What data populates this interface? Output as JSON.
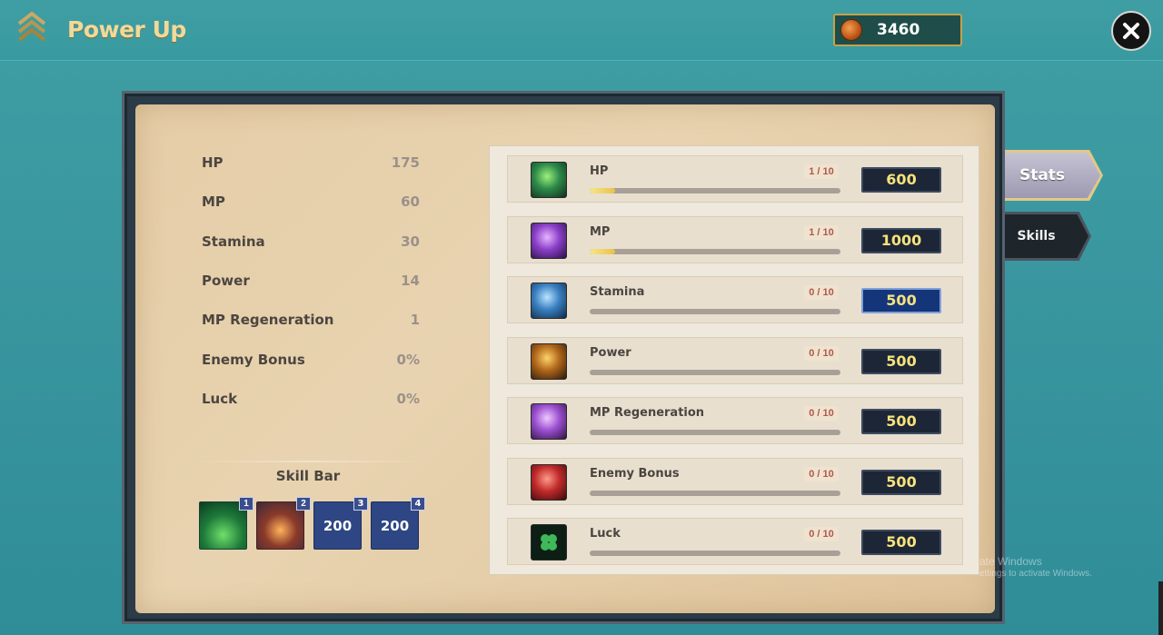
{
  "header": {
    "title": "Power Up",
    "currency_value": "3460",
    "currency_icon": "coin-icon",
    "close_icon": "close-icon"
  },
  "stats": [
    {
      "label": "HP",
      "value": "175"
    },
    {
      "label": "MP",
      "value": "60"
    },
    {
      "label": "Stamina",
      "value": "30"
    },
    {
      "label": "Power",
      "value": "14"
    },
    {
      "label": "MP Regeneration",
      "value": "1"
    },
    {
      "label": "Enemy Bonus",
      "value": "0%"
    },
    {
      "label": "Luck",
      "value": "0%"
    }
  ],
  "skill_bar": {
    "title": "Skill Bar",
    "slots": [
      {
        "number": "1",
        "icon": "skill-slime-icon"
      },
      {
        "number": "2",
        "icon": "skill-meteor-icon"
      },
      {
        "number": "3",
        "cost": "200"
      },
      {
        "number": "4",
        "cost": "200"
      }
    ]
  },
  "upgrades": [
    {
      "name": "HP",
      "level": "1 / 10",
      "progress": 0.1,
      "cost": "600",
      "icon": "hp-orb-icon"
    },
    {
      "name": "MP",
      "level": "1 / 10",
      "progress": 0.1,
      "cost": "1000",
      "icon": "mp-orb-icon"
    },
    {
      "name": "Stamina",
      "level": "0 / 10",
      "progress": 0,
      "cost": "500",
      "icon": "stamina-orb-icon"
    },
    {
      "name": "Power",
      "level": "0 / 10",
      "progress": 0,
      "cost": "500",
      "icon": "power-orb-icon"
    },
    {
      "name": "MP Regeneration",
      "level": "0 / 10",
      "progress": 0,
      "cost": "500",
      "icon": "mp-regen-orb-icon"
    },
    {
      "name": "Enemy Bonus",
      "level": "0 / 10",
      "progress": 0,
      "cost": "500",
      "icon": "enemy-bonus-crystal-icon"
    },
    {
      "name": "Luck",
      "level": "0 / 10",
      "progress": 0,
      "cost": "500",
      "icon": "clover-icon"
    }
  ],
  "tabs": {
    "stats": "Stats",
    "skills": "Skills"
  },
  "watermark": {
    "line1": "ate Windows",
    "line2": "ettings to activate Windows."
  },
  "colors": {
    "accent_gold": "#f1d99a",
    "cost_text": "#f7e27c",
    "level_text": "#b0584a"
  }
}
